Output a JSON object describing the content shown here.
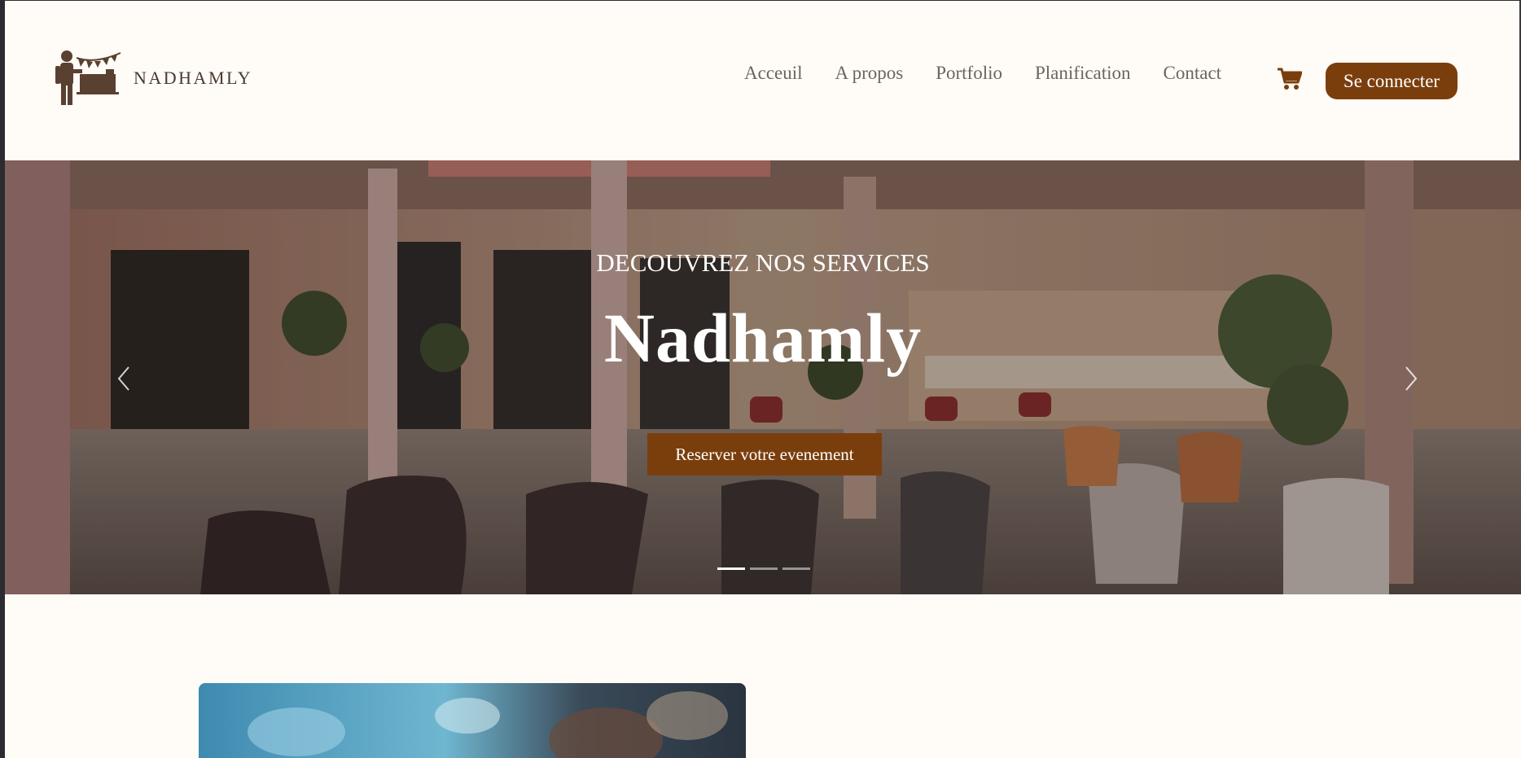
{
  "brand": {
    "name": "NADHAMLY",
    "logo_icon": "waiter-bunting-logo"
  },
  "nav": {
    "items": [
      "Acceuil",
      "A propos",
      "Portfolio",
      "Planification",
      "Contact"
    ],
    "cart_icon": "cart-icon",
    "login_label": "Se connecter"
  },
  "hero": {
    "subtitle": "DECOUVREZ NOS SERVICES",
    "title": "Nadhamly",
    "cta_label": "Reserver votre evenement",
    "slides": 3,
    "active_slide": 1
  },
  "colors": {
    "accent": "#7a3e0d",
    "page_bg": "#fffbf6",
    "nav_text": "#6b6560"
  }
}
